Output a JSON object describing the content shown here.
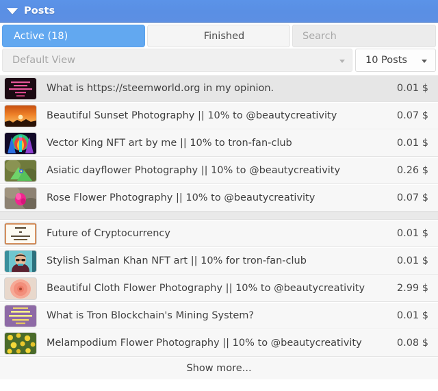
{
  "header": {
    "title": "Posts",
    "collapse_icon": "caret-down-icon",
    "background_color": "#5a8fe4"
  },
  "tabs": [
    {
      "label": "Active (18)",
      "active": true
    },
    {
      "label": "Finished",
      "active": false
    }
  ],
  "search": {
    "placeholder": "Search",
    "value": ""
  },
  "filters": {
    "view": {
      "label": "Default View",
      "options": [
        "Default View"
      ]
    },
    "count": {
      "label": "10 Posts",
      "options": [
        "10 Posts"
      ]
    }
  },
  "list": {
    "groups": [
      {
        "rows": [
          {
            "thumb": "dark-pink-text-thumbnail",
            "title": "What is https://steemworld.org in my opinion.",
            "value": "0.01 $",
            "highlight": true
          },
          {
            "thumb": "sunset-photo-thumbnail",
            "title": "Beautiful Sunset Photography || 10% to @beautycreativity",
            "value": "0.07 $",
            "highlight": false
          },
          {
            "thumb": "vector-art-thumbnail",
            "title": "Vector King NFT art by me || 10% to tron-fan-club",
            "value": "0.01 $",
            "highlight": false
          },
          {
            "thumb": "dayflower-photo-thumbnail",
            "title": "Asiatic dayflower Photography || 10% to @beautycreativity",
            "value": "0.26 $",
            "highlight": false
          },
          {
            "thumb": "rose-flower-photo-thumbnail",
            "title": "Rose Flower Photography || 10% to @beautycreativity",
            "value": "0.07 $",
            "highlight": false
          }
        ]
      },
      {
        "rows": [
          {
            "thumb": "crypto-text-card-thumbnail",
            "title": "Future of Cryptocurrency",
            "value": "0.01 $",
            "highlight": false
          },
          {
            "thumb": "portrait-art-thumbnail",
            "title": "Stylish Salman Khan NFT art || 10% for tron-fan-club",
            "value": "0.01 $",
            "highlight": false
          },
          {
            "thumb": "cloth-flower-photo-thumbnail",
            "title": "Beautiful Cloth Flower Photography || 10% to @beautycreativity",
            "value": "2.99 $",
            "highlight": false
          },
          {
            "thumb": "purple-text-card-thumbnail",
            "title": "What is Tron Blockchain's Mining System?",
            "value": "0.01 $",
            "highlight": false
          },
          {
            "thumb": "melampodium-photo-thumbnail",
            "title": "Melampodium Flower Photography || 10% to @beautycreativity",
            "value": "0.08 $",
            "highlight": false
          }
        ]
      }
    ],
    "show_more_label": "Show more..."
  }
}
